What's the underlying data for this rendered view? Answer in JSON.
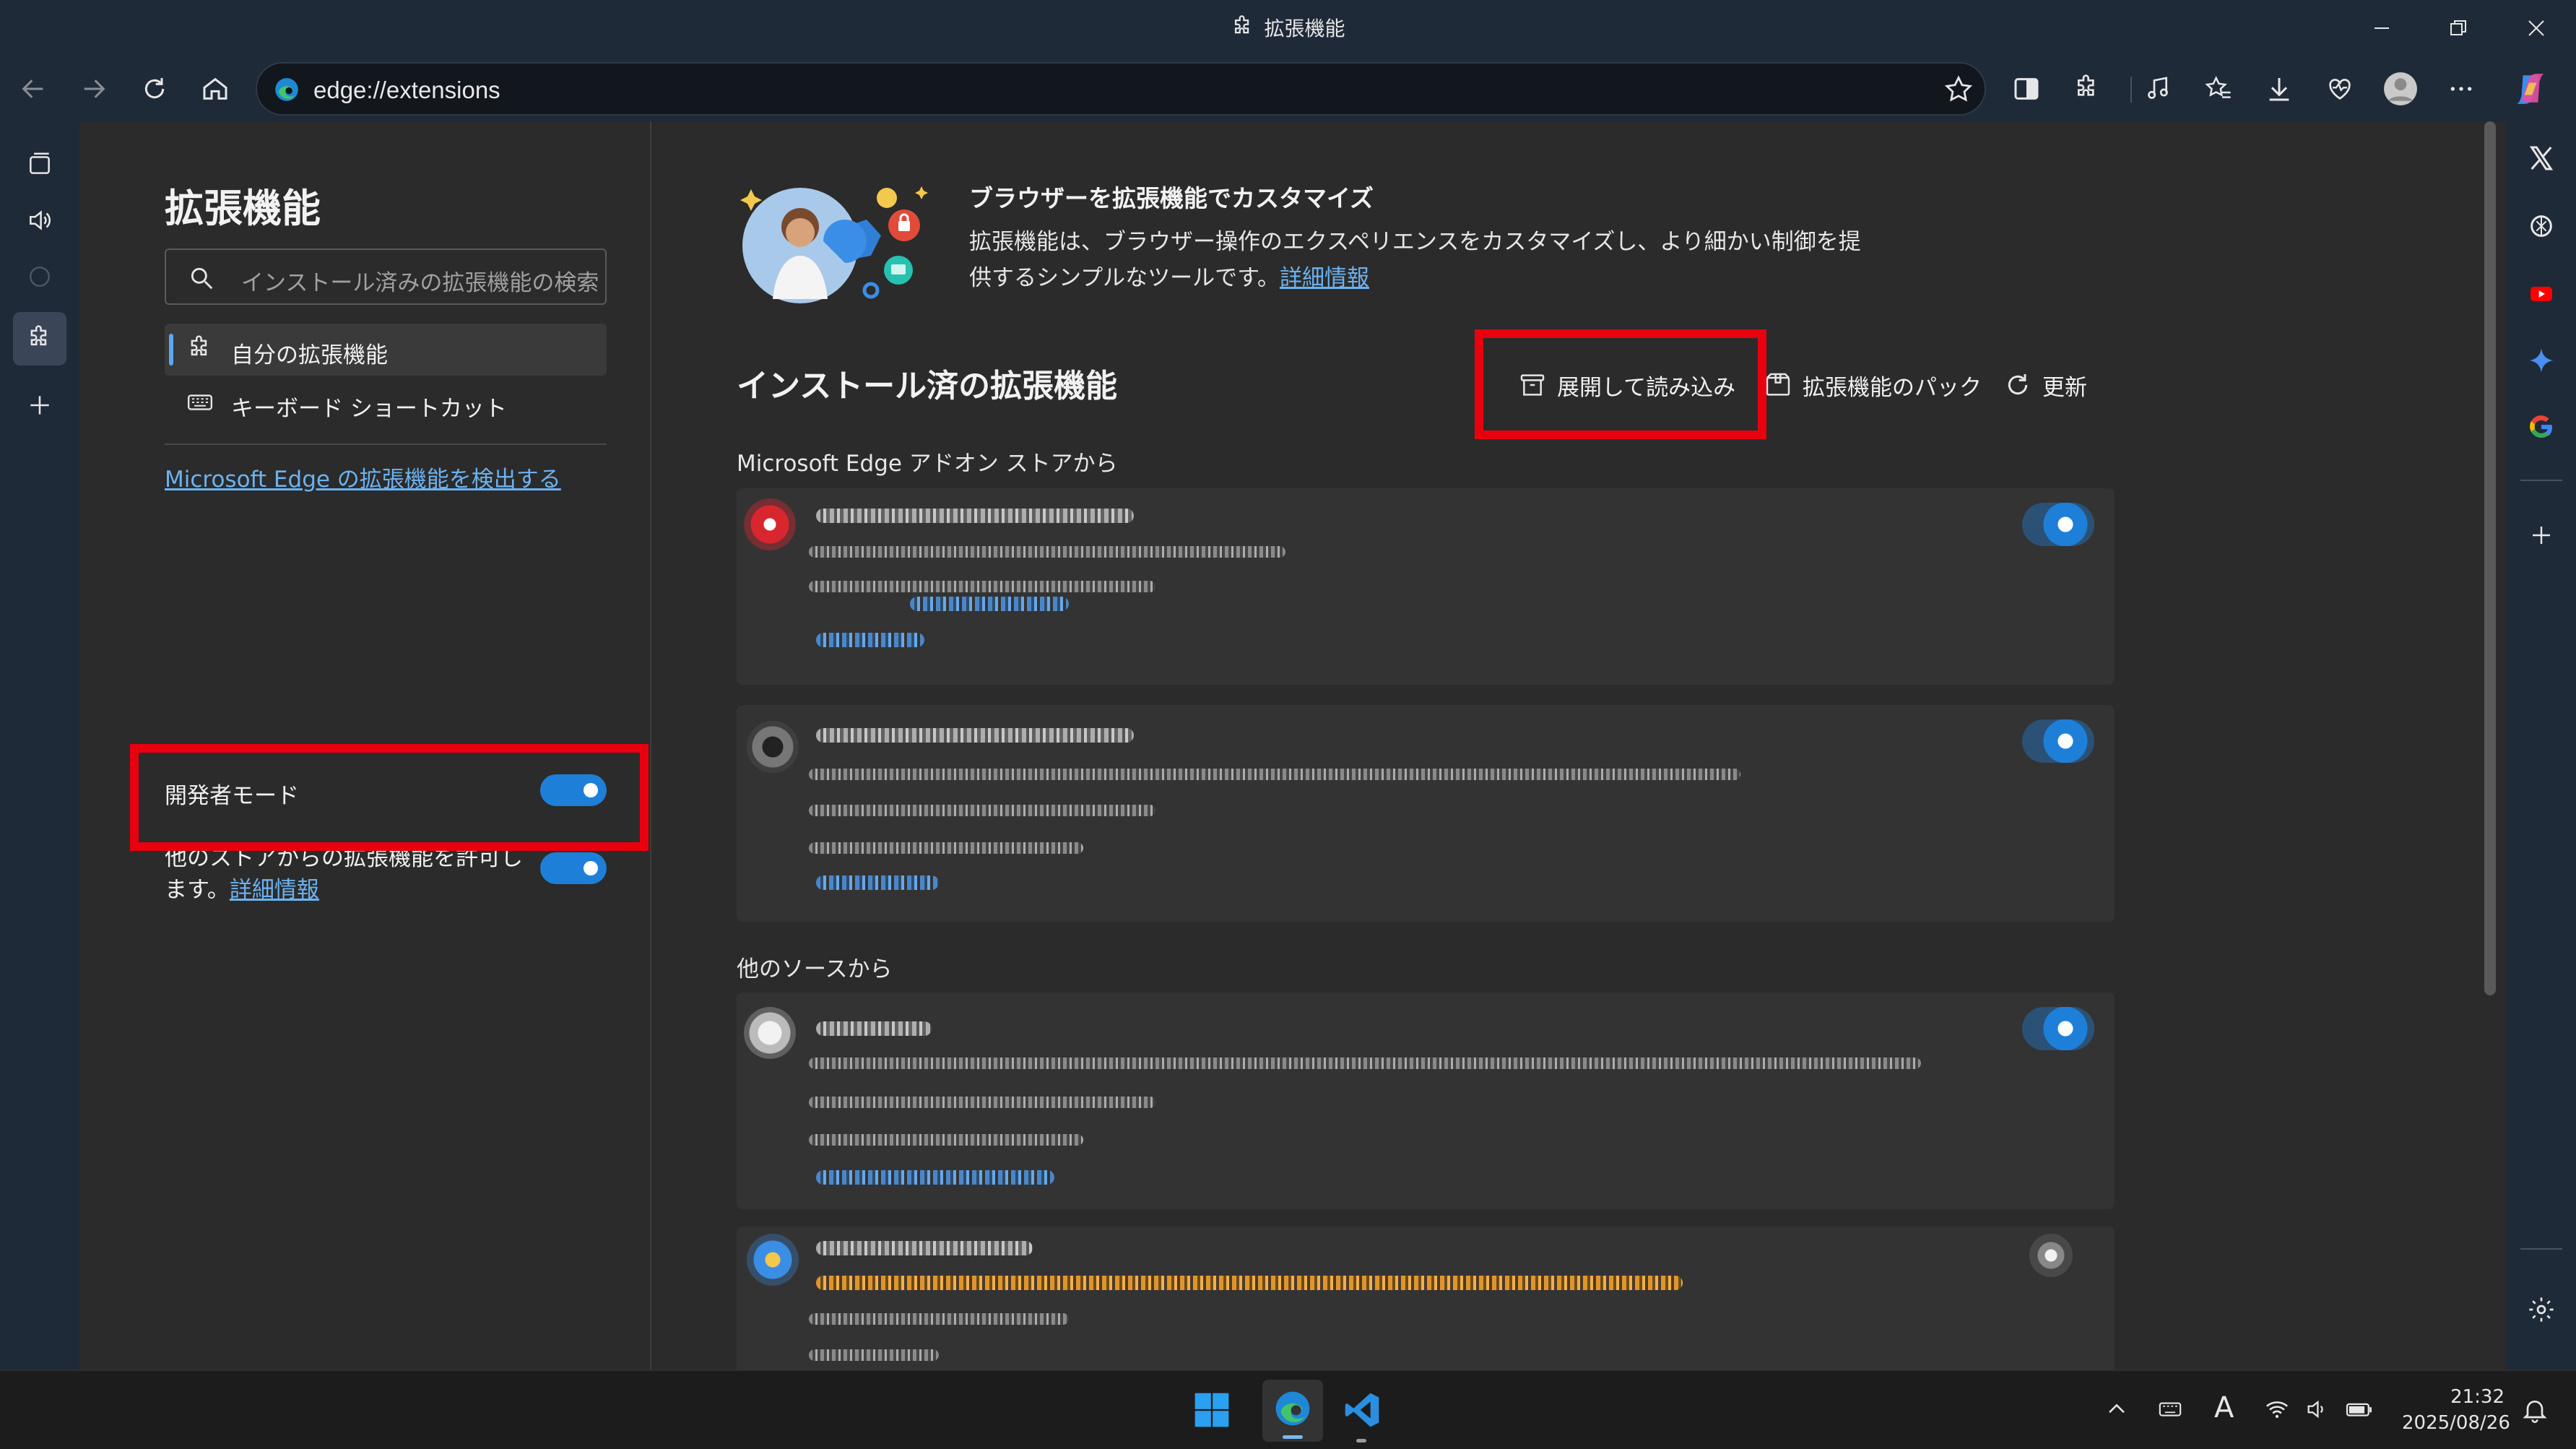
{
  "window": {
    "title": "拡張機能"
  },
  "address": {
    "url": "edge://extensions"
  },
  "nav": {
    "title": "拡張機能",
    "search_placeholder": "インストール済みの拡張機能の検索",
    "items": [
      {
        "label": "自分の拡張機能",
        "icon": "puzzle-icon",
        "selected": true
      },
      {
        "label": "キーボード ショートカット",
        "icon": "keyboard-icon",
        "selected": false
      }
    ],
    "discover_link": "Microsoft Edge の拡張機能を検出する",
    "developer_mode_label": "開発者モード",
    "developer_mode_on": true,
    "other_stores_label": "他のストアからの拡張機能を許可します。",
    "other_stores_link": "詳細情報",
    "other_stores_on": true
  },
  "banner": {
    "title": "ブラウザーを拡張機能でカスタマイズ",
    "text": "拡張機能は、ブラウザー操作のエクスペリエンスをカスタマイズし、より細かい制御を提供するシンプルなツールです。",
    "link": "詳細情報"
  },
  "main": {
    "installed_title": "インストール済の拡張機能",
    "actions": {
      "load_unpacked": "展開して読み込み",
      "pack": "拡張機能のパック",
      "update": "更新"
    },
    "store_section": "Microsoft Edge アドオン ストアから",
    "other_section": "他のソースから"
  },
  "taskbar": {
    "time": "21:32",
    "date": "2025/08/26",
    "ime": "A"
  },
  "colors": {
    "accent": "#1e7fd8",
    "highlight_box": "#e8000f",
    "link": "#6cb2f0"
  }
}
